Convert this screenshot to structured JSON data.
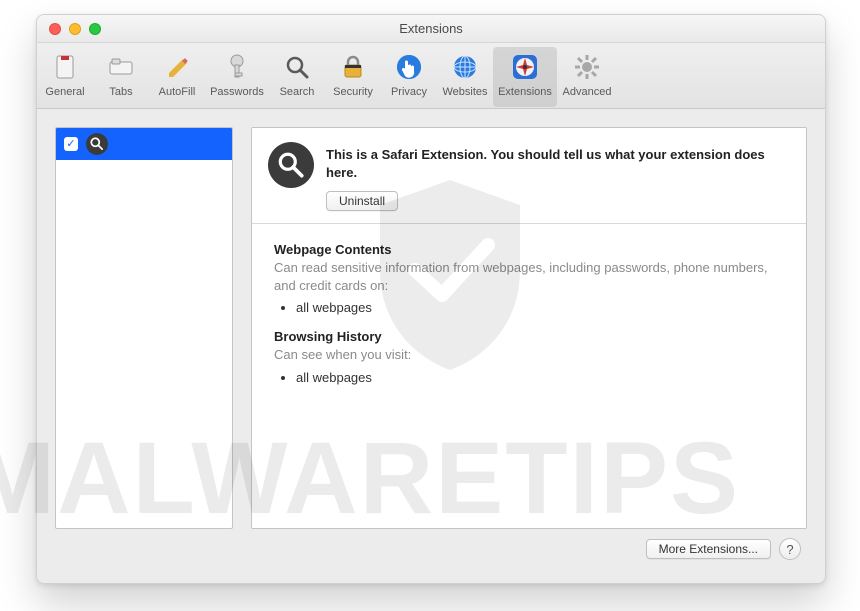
{
  "window": {
    "title": "Extensions"
  },
  "toolbar": {
    "items": [
      {
        "id": "general",
        "label": "General"
      },
      {
        "id": "tabs",
        "label": "Tabs"
      },
      {
        "id": "autofill",
        "label": "AutoFill"
      },
      {
        "id": "passwords",
        "label": "Passwords"
      },
      {
        "id": "search",
        "label": "Search"
      },
      {
        "id": "security",
        "label": "Security"
      },
      {
        "id": "privacy",
        "label": "Privacy"
      },
      {
        "id": "websites",
        "label": "Websites"
      },
      {
        "id": "extensions",
        "label": "Extensions"
      },
      {
        "id": "advanced",
        "label": "Advanced"
      }
    ],
    "active": "extensions"
  },
  "sidebar": {
    "items": [
      {
        "icon": "search-icon",
        "checked": true
      }
    ]
  },
  "extension": {
    "icon": "search-icon",
    "description": "This is a Safari Extension. You should tell us what your extension does here.",
    "uninstall_label": "Uninstall"
  },
  "permissions": {
    "sections": [
      {
        "title": "Webpage Contents",
        "desc": "Can read sensitive information from webpages, including passwords, phone numbers, and credit cards on:",
        "items": [
          "all webpages"
        ]
      },
      {
        "title": "Browsing History",
        "desc": "Can see when you visit:",
        "items": [
          "all webpages"
        ]
      }
    ]
  },
  "footer": {
    "more_label": "More Extensions...",
    "help_label": "?"
  },
  "watermark": {
    "text": "MALWARETIPS"
  }
}
